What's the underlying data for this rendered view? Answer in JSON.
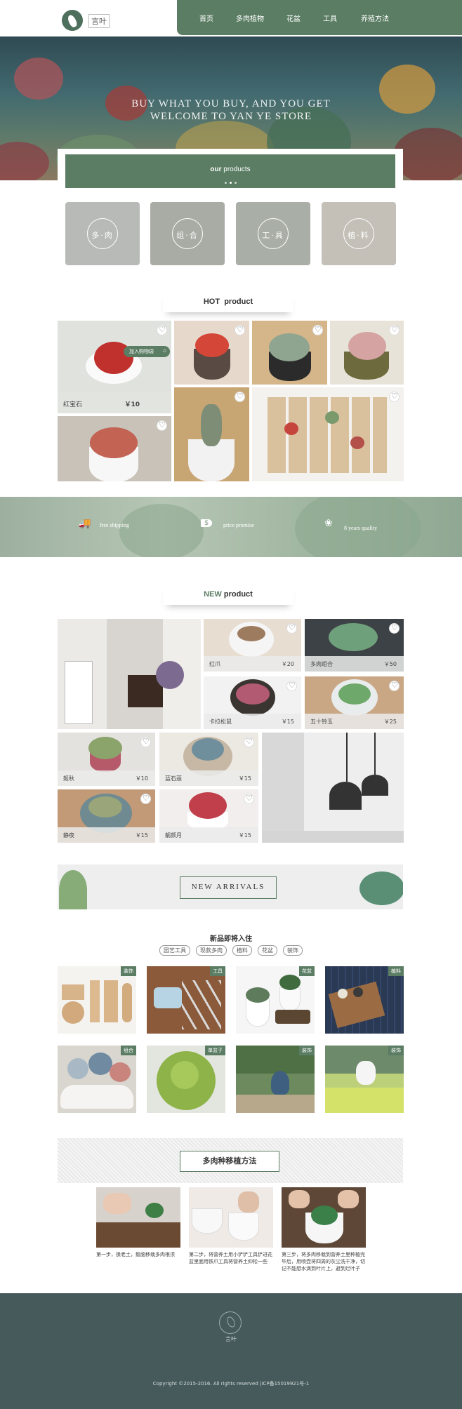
{
  "header": {
    "logo_text": "言叶",
    "nav": [
      "首页",
      "多肉植物",
      "花盆",
      "工具",
      "养殖方法"
    ]
  },
  "hero": {
    "line1": "BUY WHAT YOU BUY, AND YOU GET",
    "line2": "WELCOME TO YAN YE STORE"
  },
  "our_products": {
    "bold": "our",
    "rest": " products"
  },
  "categories": [
    "多·肉",
    "组·合",
    "工·具",
    "植·料"
  ],
  "hot": {
    "prefix": "HOT",
    "title": "product",
    "featured": {
      "cart_label": "加入购物袋",
      "name": "红宝石",
      "price": "￥10"
    }
  },
  "features": [
    "free shipping",
    "price promise",
    "8 years quality"
  ],
  "new": {
    "prefix": "NEW",
    "title": "product",
    "items": [
      {
        "name": "红爪",
        "price": "￥20"
      },
      {
        "name": "多肉组合",
        "price": "￥50"
      },
      {
        "name": "卡拉松鼠",
        "price": "￥15"
      },
      {
        "name": "五十铃玉",
        "price": "￥25"
      },
      {
        "name": "姬秋",
        "price": "￥10"
      },
      {
        "name": "蓝石莲",
        "price": "￥15"
      },
      {
        "name": "静夜",
        "price": "￥15"
      },
      {
        "name": "靓颜月",
        "price": "￥15"
      }
    ]
  },
  "arrivals": {
    "title": "NEW   ARRIVALS"
  },
  "coming": {
    "title": "新品即将入住",
    "tags": [
      "园艺工具",
      "现款多肉",
      "植料",
      "花盆",
      "装饰"
    ],
    "badges": [
      "装饰",
      "工具",
      "花盆",
      "植料",
      "组合",
      "单盆子",
      "装饰",
      "装饰"
    ]
  },
  "method": {
    "title": "多肉种移植方法",
    "steps": [
      "第一步，换老土，毅脑移栽多肉根须",
      "第二步，将营养土用小铲铲工具铲进花盆里面用铁爪工具将营养土抑松一些",
      "第三步，将多肉移栽到营养土里种植完毕后，用喷壶将四周的灰尘洗干净，切记不能想水滴到叶片上，避到烂叶子"
    ]
  },
  "footer": {
    "logo_text": "言叶",
    "copyright": "Copyright ©2015-2016. All rights reserved       |ICP备15019921号-1"
  },
  "colors": {
    "brand_green": "#5b7d64",
    "footer": "#475a5b"
  }
}
